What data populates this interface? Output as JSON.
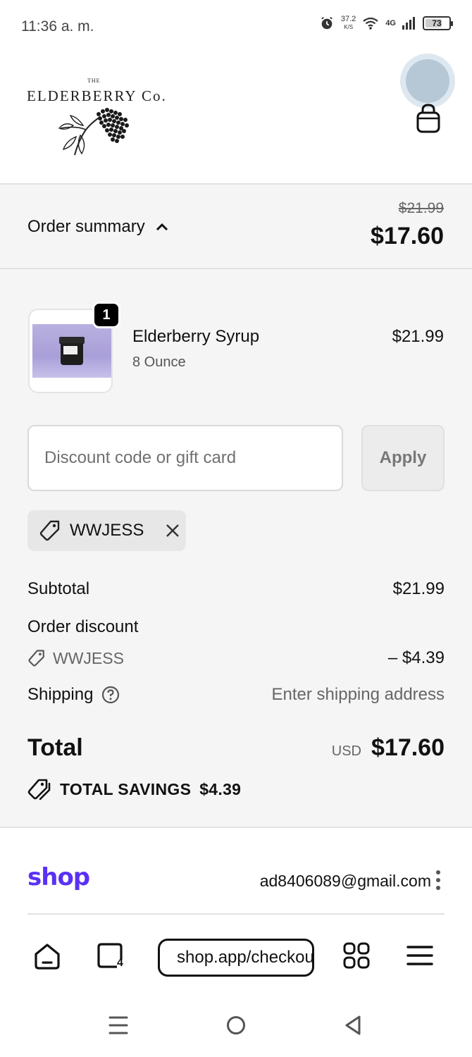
{
  "status_bar": {
    "time": "11:36 a. m.",
    "net_speed": "37.2",
    "net_unit": "K/S",
    "net_type": "4G",
    "battery": "73"
  },
  "header": {
    "logo_the": "THE",
    "logo_name": "ELDERBERRY Co."
  },
  "summary": {
    "label": "Order summary",
    "compare_price": "$21.99",
    "total": "$17.60"
  },
  "product": {
    "quantity": "1",
    "name": "Elderberry Syrup",
    "variant": "8 Ounce",
    "price": "$21.99"
  },
  "discount": {
    "placeholder": "Discount code or gift card",
    "apply_label": "Apply",
    "applied_code": "WWJESS"
  },
  "lines": {
    "subtotal_label": "Subtotal",
    "subtotal_value": "$21.99",
    "order_discount_label": "Order discount",
    "discount_code": "WWJESS",
    "discount_value": "– $4.39",
    "shipping_label": "Shipping",
    "shipping_value": "Enter shipping address"
  },
  "total": {
    "label": "Total",
    "currency": "USD",
    "amount": "$17.60"
  },
  "savings": {
    "label": "TOTAL SAVINGS",
    "amount": "$4.39"
  },
  "shop": {
    "logo": "shop",
    "email": "ad8406089@gmail.com"
  },
  "browser": {
    "url": "shop.app/checkout",
    "tab_count": "4"
  },
  "colors": {
    "shop_brand": "#5a31f4",
    "summary_bg": "#f5f5f5"
  }
}
